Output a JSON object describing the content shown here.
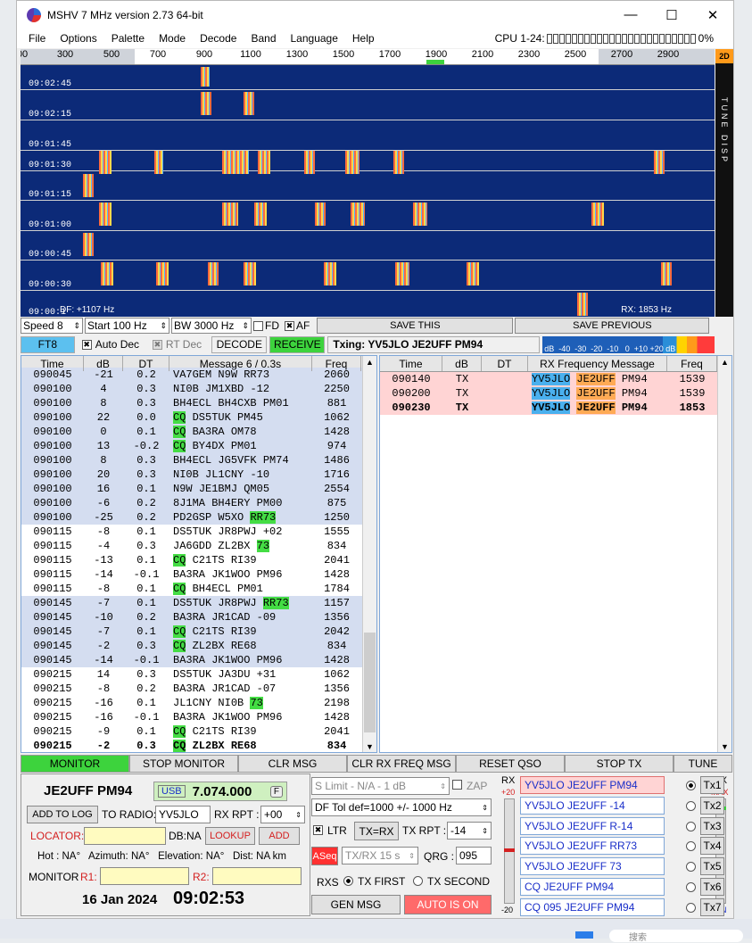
{
  "window": {
    "title": "MSHV 7 MHz version 2.73 64-bit",
    "min_icon": "minimize-icon",
    "max_icon": "maximize-icon",
    "close_icon": "close-icon",
    "min": "—",
    "max": "☐",
    "close": "✕"
  },
  "menu": [
    "File",
    "Options",
    "Palette",
    "Mode",
    "Decode",
    "Band",
    "Language",
    "Help"
  ],
  "cpu": {
    "label": "CPU 1-24:",
    "value": "0%"
  },
  "scale": {
    "ticks": [
      "00",
      "300",
      "500",
      "700",
      "900",
      "1100",
      "1300",
      "1500",
      "1700",
      "1900",
      "2100",
      "2300",
      "2500",
      "2700",
      "2900"
    ],
    "mode_label": "2D"
  },
  "waterfall": {
    "times": [
      "09:02:45",
      "09:02:15",
      "09:01:45",
      "09:01:30",
      "09:01:15",
      "09:01:00",
      "09:00:45",
      "09:00:30",
      "09:00:1"
    ],
    "df": "DF: +1107 Hz",
    "rx": "RX: 1853 Hz",
    "side_text": "TUNE DISP"
  },
  "controls": {
    "speed": "Speed 8",
    "start": "Start 100 Hz",
    "bw": "BW 3000 Hz",
    "fd": "FD",
    "af": "AF",
    "save_this": "SAVE THIS",
    "save_prev": "SAVE PREVIOUS"
  },
  "status": {
    "mode": "FT8",
    "auto_dec": "Auto Dec",
    "rt_dec": "RT Dec",
    "decode": "DECODE",
    "receive": "RECEIVE",
    "txing": "Txing: YV5JLO JE2UFF PM94",
    "meter_labels": "dB  -40  -30  -20  -10   0  +10 +20 dB"
  },
  "left_table": {
    "headers": [
      "Time",
      "dB",
      "DT",
      "Message 6 / 0.3s",
      "Freq"
    ],
    "rows": [
      {
        "t": "090045",
        "db": "-21",
        "dt": "0.2",
        "msg": "VA7GEM N9W RR73",
        "f": "2060",
        "style": "blue",
        "tags": []
      },
      {
        "t": "090100",
        "db": "4",
        "dt": "0.3",
        "msg": "NI0B JM1XBD -12",
        "f": "2250",
        "style": "blue",
        "tags": []
      },
      {
        "t": "090100",
        "db": "8",
        "dt": "0.3",
        "msg": "BH4ECL BH4CXB PM01",
        "f": "881",
        "style": "blue",
        "tags": []
      },
      {
        "t": "090100",
        "db": "22",
        "dt": "0.0",
        "msg": "CQ DS5TUK PM45",
        "f": "1062",
        "style": "blue",
        "tags": [
          "cq"
        ]
      },
      {
        "t": "090100",
        "db": "0",
        "dt": "0.1",
        "msg": "CQ BA3RA OM78",
        "f": "1428",
        "style": "blue",
        "tags": [
          "cq"
        ]
      },
      {
        "t": "090100",
        "db": "13",
        "dt": "-0.2",
        "msg": "CQ BY4DX PM01",
        "f": "974",
        "style": "blue",
        "tags": [
          "cq"
        ]
      },
      {
        "t": "090100",
        "db": "8",
        "dt": "0.3",
        "msg": "BH4ECL JG5VFK PM74",
        "f": "1486",
        "style": "blue",
        "tags": []
      },
      {
        "t": "090100",
        "db": "20",
        "dt": "0.3",
        "msg": "NI0B JL1CNY -10",
        "f": "1716",
        "style": "blue",
        "tags": []
      },
      {
        "t": "090100",
        "db": "16",
        "dt": "0.1",
        "msg": "N9W JE1BMJ QM05",
        "f": "2554",
        "style": "blue",
        "tags": []
      },
      {
        "t": "090100",
        "db": "-6",
        "dt": "0.2",
        "msg": "8J1MA BH4ERY PM00",
        "f": "875",
        "style": "blue",
        "tags": []
      },
      {
        "t": "090100",
        "db": "-25",
        "dt": "0.2",
        "msg": "PD2GSP W5XO RR73",
        "f": "1250",
        "style": "blue",
        "tags": [
          "rr"
        ]
      },
      {
        "t": "090115",
        "db": "-8",
        "dt": "0.1",
        "msg": "DS5TUK JR8PWJ +02",
        "f": "1555",
        "style": "white",
        "tags": []
      },
      {
        "t": "090115",
        "db": "-4",
        "dt": "0.3",
        "msg": "JA6GDD ZL2BX 73",
        "f": "834",
        "style": "white",
        "tags": [
          "73"
        ]
      },
      {
        "t": "090115",
        "db": "-13",
        "dt": "0.1",
        "msg": "CQ C21TS RI39",
        "f": "2041",
        "style": "white",
        "tags": [
          "cq"
        ]
      },
      {
        "t": "090115",
        "db": "-14",
        "dt": "-0.1",
        "msg": "BA3RA JK1WOO PM96",
        "f": "1428",
        "style": "white",
        "tags": []
      },
      {
        "t": "090115",
        "db": "-8",
        "dt": "0.1",
        "msg": "CQ BH4ECL PM01",
        "f": "1784",
        "style": "white",
        "tags": [
          "cq"
        ]
      },
      {
        "t": "090145",
        "db": "-7",
        "dt": "0.1",
        "msg": "DS5TUK JR8PWJ RR73",
        "f": "1157",
        "style": "blue",
        "tags": [
          "rr"
        ]
      },
      {
        "t": "090145",
        "db": "-10",
        "dt": "0.2",
        "msg": "BA3RA JR1CAD -09",
        "f": "1356",
        "style": "blue",
        "tags": []
      },
      {
        "t": "090145",
        "db": "-7",
        "dt": "0.1",
        "msg": "CQ C21TS RI39",
        "f": "2042",
        "style": "blue",
        "tags": [
          "cq"
        ]
      },
      {
        "t": "090145",
        "db": "-2",
        "dt": "0.3",
        "msg": "CQ ZL2BX RE68",
        "f": "834",
        "style": "blue",
        "tags": [
          "cq"
        ]
      },
      {
        "t": "090145",
        "db": "-14",
        "dt": "-0.1",
        "msg": "BA3RA JK1WOO PM96",
        "f": "1428",
        "style": "blue",
        "tags": []
      },
      {
        "t": "090215",
        "db": "14",
        "dt": "0.3",
        "msg": "DS5TUK JA3DU +31",
        "f": "1062",
        "style": "white",
        "tags": []
      },
      {
        "t": "090215",
        "db": "-8",
        "dt": "0.2",
        "msg": "BA3RA JR1CAD -07",
        "f": "1356",
        "style": "white",
        "tags": []
      },
      {
        "t": "090215",
        "db": "-16",
        "dt": "0.1",
        "msg": "JL1CNY NI0B 73",
        "f": "2198",
        "style": "white",
        "tags": [
          "73"
        ]
      },
      {
        "t": "090215",
        "db": "-16",
        "dt": "-0.1",
        "msg": "BA3RA JK1WOO PM96",
        "f": "1428",
        "style": "white",
        "tags": []
      },
      {
        "t": "090215",
        "db": "-9",
        "dt": "0.1",
        "msg": "CQ C21TS RI39",
        "f": "2041",
        "style": "white",
        "tags": [
          "cq"
        ]
      },
      {
        "t": "090215",
        "db": "-2",
        "dt": "0.3",
        "msg": "CQ ZL2BX RE68",
        "f": "834",
        "style": "bold",
        "tags": [
          "cq"
        ]
      }
    ]
  },
  "right_table": {
    "headers": [
      "Time",
      "dB",
      "DT",
      "RX Frequency Message",
      "Freq"
    ],
    "rows": [
      {
        "t": "090140",
        "db": "TX",
        "dt": "",
        "call": "YV5JLO",
        "my": "JE2UFF",
        "rest": "PM94",
        "f": "1539",
        "bold": false
      },
      {
        "t": "090200",
        "db": "TX",
        "dt": "",
        "call": "YV5JLO",
        "my": "JE2UFF",
        "rest": "PM94",
        "f": "1539",
        "bold": false
      },
      {
        "t": "090230",
        "db": "TX",
        "dt": "",
        "call": "YV5JLO",
        "my": "JE2UFF",
        "rest": "PM94",
        "f": "1853",
        "bold": true
      }
    ]
  },
  "buttons": [
    "MONITOR",
    "STOP MONITOR",
    "CLR MSG",
    "CLR RX FREQ MSG",
    "RESET QSO",
    "STOP TX",
    "TUNE"
  ],
  "station": {
    "call_grid": "JE2UFF PM94",
    "mode": "USB",
    "freq": "7.074.000",
    "f_btn": "F",
    "add_log": "ADD TO LOG",
    "to_radio": "TO RADIO:",
    "to_radio_val": "YV5JLO",
    "rx_rpt": "RX RPT :",
    "rx_rpt_val": "+00",
    "locator": "LOCATOR:",
    "db": "DB:NA",
    "lookup": "LOOKUP",
    "add": "ADD",
    "info": "Hot : NA°   Azimuth: NA°   Elevation: NA°   Dist: NA km",
    "monitor": "MONITOR",
    "r1": "R1:",
    "r2": "R2:",
    "date": "16 Jan 2024",
    "time": "09:02:53"
  },
  "mid": {
    "slimit": "S Limit - N/A - 1  dB",
    "zap": "ZAP",
    "dftol": "DF Tol def=1000 +/-  1000  Hz",
    "ltr": "LTR",
    "tx_rx": "TX=RX",
    "tx_rpt": "TX RPT :",
    "tx_rpt_val": "-14",
    "aseq": "ASeq",
    "txrx": "TX/RX 15  s",
    "qrg": "QRG :",
    "qrg_val": "095",
    "rxs": "RXS",
    "tx_first": "TX FIRST",
    "tx_second": "TX SECOND",
    "gen_msg": "GEN MSG",
    "auto": "AUTO IS ON"
  },
  "tx_msgs": {
    "rx_label": "RX",
    "plus20": "+20",
    "minus20": "-20",
    "tx_label": "TX",
    "max": "MAX",
    "min": "MIN",
    "items": [
      {
        "msg": "YV5JLO JE2UFF PM94",
        "btn": "Tx1"
      },
      {
        "msg": "YV5JLO JE2UFF -14",
        "btn": "Tx2"
      },
      {
        "msg": "YV5JLO JE2UFF R-14",
        "btn": "Tx3"
      },
      {
        "msg": "YV5JLO JE2UFF RR73",
        "btn": "Tx4"
      },
      {
        "msg": "YV5JLO JE2UFF 73",
        "btn": "Tx5"
      },
      {
        "msg": "CQ JE2UFF PM94",
        "btn": "Tx6"
      },
      {
        "msg": "CQ 095 JE2UFF PM94",
        "btn": "Tx7"
      }
    ]
  },
  "taskbar": {
    "search": "搜索"
  }
}
